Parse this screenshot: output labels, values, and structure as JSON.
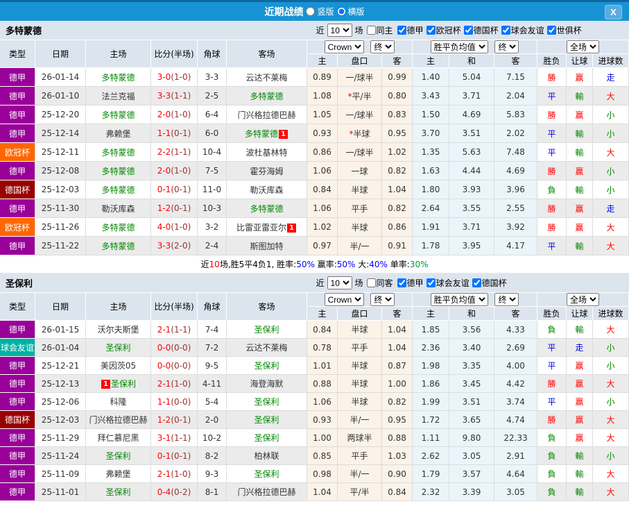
{
  "titlebar": {
    "title": "近期战绩",
    "vertical_label": "竖版",
    "horizontal_label": "横版",
    "close_label": "X"
  },
  "table_header": {
    "columns": {
      "type": "类型",
      "date": "日期",
      "home": "主场",
      "score": "比分(半场)",
      "corner": "角球",
      "away": "客场",
      "h": "主",
      "handicap": "盘口",
      "a": "客",
      "avg_h": "主",
      "avg_d": "和",
      "avg_a": "客",
      "outcome": "胜负",
      "let_ball": "让球",
      "goals": "进球数"
    },
    "selects": {
      "bookmaker": "Crown",
      "final": "终",
      "avg": "胜平负均值",
      "scope": "全场"
    }
  },
  "colors": {
    "league": {
      "德甲": "#990099",
      "欧冠杯": "#ff6600",
      "德国杯": "#990000",
      "球会友谊": "#00b2a2"
    },
    "result": {
      "勝": "#ff0000",
      "負": "#008800",
      "平": "#0000dd",
      "赢": "#ff0000",
      "輸": "#008800",
      "走": "#0000dd",
      "大": "#ff0000",
      "小": "#008800"
    },
    "team_green": "#008800",
    "score_ft": "#ff0000",
    "score_ht": "#993333"
  },
  "sections": [
    {
      "team": "多特蒙德",
      "filters": {
        "near_label": "近",
        "count": "10",
        "games_label": "场",
        "same_label": "同主",
        "leagues": [
          "德甲",
          "欧冠杯",
          "德国杯",
          "球会友谊",
          "世俱杯"
        ]
      },
      "rows": [
        {
          "type": "德甲",
          "date": "26-01-14",
          "home": "多特蒙德",
          "home_green": true,
          "ft": "3-0",
          "ht": "(1-0)",
          "corner": "3-3",
          "away": "云达不莱梅",
          "away_green": false,
          "star": false,
          "odds": [
            "0.89",
            "一/球半",
            "0.99"
          ],
          "avg": [
            "1.40",
            "5.04",
            "7.15"
          ],
          "res": [
            "勝",
            "赢",
            "走"
          ]
        },
        {
          "type": "德甲",
          "date": "26-01-10",
          "home": "法兰克福",
          "home_green": false,
          "ft": "3-3",
          "ht": "(1-1)",
          "corner": "2-5",
          "away": "多特蒙德",
          "away_green": true,
          "star": true,
          "odds": [
            "1.08",
            "平/半",
            "0.80"
          ],
          "avg": [
            "3.43",
            "3.71",
            "2.04"
          ],
          "res": [
            "平",
            "輸",
            "大"
          ]
        },
        {
          "type": "德甲",
          "date": "25-12-20",
          "home": "多特蒙德",
          "home_green": true,
          "ft": "2-0",
          "ht": "(1-0)",
          "corner": "6-4",
          "away": "门兴格拉德巴赫",
          "away_green": false,
          "star": false,
          "odds": [
            "1.05",
            "一/球半",
            "0.83"
          ],
          "avg": [
            "1.50",
            "4.69",
            "5.83"
          ],
          "res": [
            "勝",
            "赢",
            "小"
          ]
        },
        {
          "type": "德甲",
          "date": "25-12-14",
          "home": "弗赖堡",
          "home_green": false,
          "ft": "1-1",
          "ht": "(0-1)",
          "corner": "6-0",
          "away": "多特蒙德",
          "away_green": true,
          "away_badge": "1",
          "star": true,
          "odds": [
            "0.93",
            "半球",
            "0.95"
          ],
          "avg": [
            "3.70",
            "3.51",
            "2.02"
          ],
          "res": [
            "平",
            "輸",
            "小"
          ]
        },
        {
          "type": "欧冠杯",
          "date": "25-12-11",
          "home": "多特蒙德",
          "home_green": true,
          "ft": "2-2",
          "ht": "(1-1)",
          "corner": "10-4",
          "away": "波杜基林特",
          "away_green": false,
          "star": false,
          "odds": [
            "0.86",
            "一/球半",
            "1.02"
          ],
          "avg": [
            "1.35",
            "5.63",
            "7.48"
          ],
          "res": [
            "平",
            "輸",
            "大"
          ]
        },
        {
          "type": "德甲",
          "date": "25-12-08",
          "home": "多特蒙德",
          "home_green": true,
          "ft": "2-0",
          "ht": "(1-0)",
          "corner": "7-5",
          "away": "霍芬海姆",
          "away_green": false,
          "star": false,
          "odds": [
            "1.06",
            "一球",
            "0.82"
          ],
          "avg": [
            "1.63",
            "4.44",
            "4.69"
          ],
          "res": [
            "勝",
            "赢",
            "小"
          ]
        },
        {
          "type": "德国杯",
          "date": "25-12-03",
          "home": "多特蒙德",
          "home_green": true,
          "ft": "0-1",
          "ht": "(0-1)",
          "corner": "11-0",
          "away": "勒沃库森",
          "away_green": false,
          "star": false,
          "odds": [
            "0.84",
            "半球",
            "1.04"
          ],
          "avg": [
            "1.80",
            "3.93",
            "3.96"
          ],
          "res": [
            "負",
            "輸",
            "小"
          ]
        },
        {
          "type": "德甲",
          "date": "25-11-30",
          "home": "勒沃库森",
          "home_green": false,
          "ft": "1-2",
          "ht": "(0-1)",
          "corner": "10-3",
          "away": "多特蒙德",
          "away_green": true,
          "star": false,
          "odds": [
            "1.06",
            "平手",
            "0.82"
          ],
          "avg": [
            "2.64",
            "3.55",
            "2.55"
          ],
          "res": [
            "勝",
            "赢",
            "走"
          ]
        },
        {
          "type": "欧冠杯",
          "date": "25-11-26",
          "home": "多特蒙德",
          "home_green": true,
          "ft": "4-0",
          "ht": "(1-0)",
          "corner": "3-2",
          "away": "比雷亚雷亚尔",
          "away_green": false,
          "away_badge": "1",
          "star": false,
          "odds": [
            "1.02",
            "半球",
            "0.86"
          ],
          "avg": [
            "1.91",
            "3.71",
            "3.92"
          ],
          "res": [
            "勝",
            "赢",
            "大"
          ]
        },
        {
          "type": "德甲",
          "date": "25-11-22",
          "home": "多特蒙德",
          "home_green": true,
          "ft": "3-3",
          "ht": "(2-0)",
          "corner": "2-4",
          "away": "斯图加特",
          "away_green": false,
          "star": false,
          "odds": [
            "0.97",
            "半/一",
            "0.91"
          ],
          "avg": [
            "1.78",
            "3.95",
            "4.17"
          ],
          "res": [
            "平",
            "輸",
            "大"
          ]
        }
      ],
      "summary": [
        {
          "t": "近",
          "c": "#000000"
        },
        {
          "t": "10",
          "c": "#ff0000"
        },
        {
          "t": "场,胜5平4负1, 胜率:",
          "c": "#000000"
        },
        {
          "t": "50%",
          "c": "#0000ff"
        },
        {
          "t": " 赢率:",
          "c": "#000000"
        },
        {
          "t": "50%",
          "c": "#0000ff"
        },
        {
          "t": " 大:",
          "c": "#000000"
        },
        {
          "t": "40%",
          "c": "#0000ff"
        },
        {
          "t": " 单率:",
          "c": "#000000"
        },
        {
          "t": "30%",
          "c": "#009933"
        }
      ]
    },
    {
      "team": "圣保利",
      "filters": {
        "near_label": "近",
        "count": "10",
        "games_label": "场",
        "same_label": "同客",
        "leagues": [
          "德甲",
          "球会友谊",
          "德国杯"
        ]
      },
      "rows": [
        {
          "type": "德甲",
          "date": "26-01-15",
          "home": "沃尔夫斯堡",
          "home_green": false,
          "ft": "2-1",
          "ht": "(1-1)",
          "corner": "7-4",
          "away": "圣保利",
          "away_green": true,
          "star": false,
          "odds": [
            "0.84",
            "半球",
            "1.04"
          ],
          "avg": [
            "1.85",
            "3.56",
            "4.33"
          ],
          "res": [
            "負",
            "輸",
            "大"
          ]
        },
        {
          "type": "球会友谊",
          "date": "26-01-04",
          "home": "圣保利",
          "home_green": true,
          "ft": "0-0",
          "ht": "(0-0)",
          "corner": "7-2",
          "away": "云达不莱梅",
          "away_green": false,
          "star": false,
          "odds": [
            "0.78",
            "平手",
            "1.04"
          ],
          "avg": [
            "2.36",
            "3.40",
            "2.69"
          ],
          "res": [
            "平",
            "走",
            "小"
          ]
        },
        {
          "type": "德甲",
          "date": "25-12-21",
          "home": "美因茨05",
          "home_green": false,
          "ft": "0-0",
          "ht": "(0-0)",
          "corner": "9-5",
          "away": "圣保利",
          "away_green": true,
          "star": false,
          "odds": [
            "1.01",
            "半球",
            "0.87"
          ],
          "avg": [
            "1.98",
            "3.35",
            "4.00"
          ],
          "res": [
            "平",
            "赢",
            "小"
          ]
        },
        {
          "type": "德甲",
          "date": "25-12-13",
          "home": "圣保利",
          "home_green": true,
          "home_badge": "1",
          "badge_left": true,
          "ft": "2-1",
          "ht": "(1-0)",
          "corner": "4-11",
          "away": "海登海默",
          "away_green": false,
          "star": false,
          "odds": [
            "0.88",
            "半球",
            "1.00"
          ],
          "avg": [
            "1.86",
            "3.45",
            "4.42"
          ],
          "res": [
            "勝",
            "赢",
            "大"
          ]
        },
        {
          "type": "德甲",
          "date": "25-12-06",
          "home": "科隆",
          "home_green": false,
          "ft": "1-1",
          "ht": "(0-0)",
          "corner": "5-4",
          "away": "圣保利",
          "away_green": true,
          "star": false,
          "odds": [
            "1.06",
            "半球",
            "0.82"
          ],
          "avg": [
            "1.99",
            "3.51",
            "3.74"
          ],
          "res": [
            "平",
            "赢",
            "小"
          ]
        },
        {
          "type": "德国杯",
          "date": "25-12-03",
          "home": "门兴格拉德巴赫",
          "home_green": false,
          "ft": "1-2",
          "ht": "(0-1)",
          "corner": "2-0",
          "away": "圣保利",
          "away_green": true,
          "star": false,
          "odds": [
            "0.93",
            "半/一",
            "0.95"
          ],
          "avg": [
            "1.72",
            "3.65",
            "4.74"
          ],
          "res": [
            "勝",
            "赢",
            "大"
          ]
        },
        {
          "type": "德甲",
          "date": "25-11-29",
          "home": "拜仁慕尼黑",
          "home_green": false,
          "ft": "3-1",
          "ht": "(1-1)",
          "corner": "10-2",
          "away": "圣保利",
          "away_green": true,
          "star": false,
          "odds": [
            "1.00",
            "两球半",
            "0.88"
          ],
          "avg": [
            "1.11",
            "9.80",
            "22.33"
          ],
          "res": [
            "負",
            "赢",
            "大"
          ]
        },
        {
          "type": "德甲",
          "date": "25-11-24",
          "home": "圣保利",
          "home_green": true,
          "ft": "0-1",
          "ht": "(0-1)",
          "corner": "8-2",
          "away": "柏林联",
          "away_green": false,
          "star": false,
          "odds": [
            "0.85",
            "平手",
            "1.03"
          ],
          "avg": [
            "2.62",
            "3.05",
            "2.91"
          ],
          "res": [
            "負",
            "輸",
            "小"
          ]
        },
        {
          "type": "德甲",
          "date": "25-11-09",
          "home": "弗赖堡",
          "home_green": false,
          "ft": "2-1",
          "ht": "(1-0)",
          "corner": "9-3",
          "away": "圣保利",
          "away_green": true,
          "star": false,
          "odds": [
            "0.98",
            "半/一",
            "0.90"
          ],
          "avg": [
            "1.79",
            "3.57",
            "4.64"
          ],
          "res": [
            "負",
            "輸",
            "大"
          ]
        },
        {
          "type": "德甲",
          "date": "25-11-01",
          "home": "圣保利",
          "home_green": true,
          "ft": "0-4",
          "ht": "(0-2)",
          "corner": "8-1",
          "away": "门兴格拉德巴赫",
          "away_green": false,
          "star": false,
          "odds": [
            "1.04",
            "平/半",
            "0.84"
          ],
          "avg": [
            "2.32",
            "3.39",
            "3.05"
          ],
          "res": [
            "負",
            "輸",
            "大"
          ]
        }
      ],
      "summary": []
    }
  ]
}
